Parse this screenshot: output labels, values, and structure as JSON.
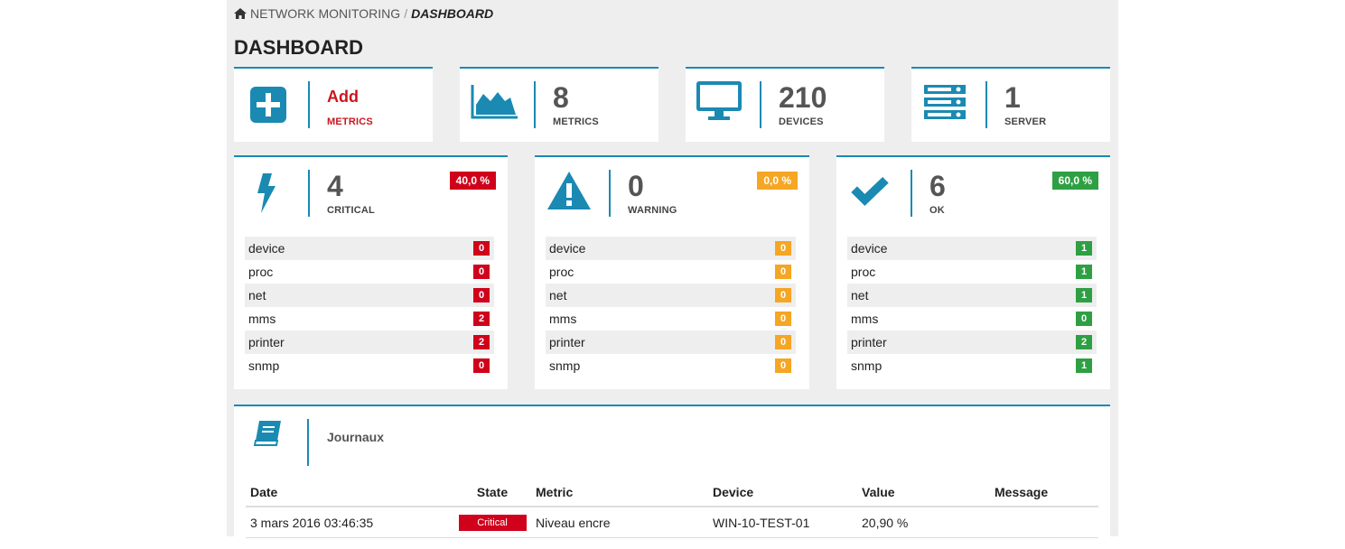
{
  "breadcrumb": {
    "root": "NETWORK MONITORING",
    "separator": "/",
    "current": "DASHBOARD",
    "home_icon": "home-icon"
  },
  "page_title": "DASHBOARD",
  "colors": {
    "accent": "#1a8ab3",
    "critical": "#d0021b",
    "warning": "#f5a623",
    "ok": "#2ea043"
  },
  "summary": [
    {
      "icon": "plus-square-icon",
      "value": "Add",
      "label": "METRICS"
    },
    {
      "icon": "area-chart-icon",
      "value": "8",
      "label": "METRICS"
    },
    {
      "icon": "monitor-icon",
      "value": "210",
      "label": "DEVICES"
    },
    {
      "icon": "server-icon",
      "value": "1",
      "label": "SERVER"
    }
  ],
  "status": [
    {
      "icon": "bolt-icon",
      "value": "4",
      "label": "CRITICAL",
      "percent": "40,0 %",
      "items": [
        {
          "name": "device",
          "count": "0"
        },
        {
          "name": "proc",
          "count": "0"
        },
        {
          "name": "net",
          "count": "0"
        },
        {
          "name": "mms",
          "count": "2"
        },
        {
          "name": "printer",
          "count": "2"
        },
        {
          "name": "snmp",
          "count": "0"
        }
      ]
    },
    {
      "icon": "warning-icon",
      "value": "0",
      "label": "WARNING",
      "percent": "0,0 %",
      "items": [
        {
          "name": "device",
          "count": "0"
        },
        {
          "name": "proc",
          "count": "0"
        },
        {
          "name": "net",
          "count": "0"
        },
        {
          "name": "mms",
          "count": "0"
        },
        {
          "name": "printer",
          "count": "0"
        },
        {
          "name": "snmp",
          "count": "0"
        }
      ]
    },
    {
      "icon": "check-icon",
      "value": "6",
      "label": "OK",
      "percent": "60,0 %",
      "items": [
        {
          "name": "device",
          "count": "1"
        },
        {
          "name": "proc",
          "count": "1"
        },
        {
          "name": "net",
          "count": "1"
        },
        {
          "name": "mms",
          "count": "0"
        },
        {
          "name": "printer",
          "count": "2"
        },
        {
          "name": "snmp",
          "count": "1"
        }
      ]
    }
  ],
  "journal": {
    "icon": "book-icon",
    "title": "Journaux",
    "columns": [
      "Date",
      "State",
      "Metric",
      "Device",
      "Value",
      "Message"
    ],
    "rows": [
      {
        "date": "3 mars 2016 03:46:35",
        "state": "Critical",
        "metric": "Niveau encre",
        "device": "WIN-10-TEST-01",
        "value": "20,90 %",
        "message": ""
      }
    ]
  }
}
